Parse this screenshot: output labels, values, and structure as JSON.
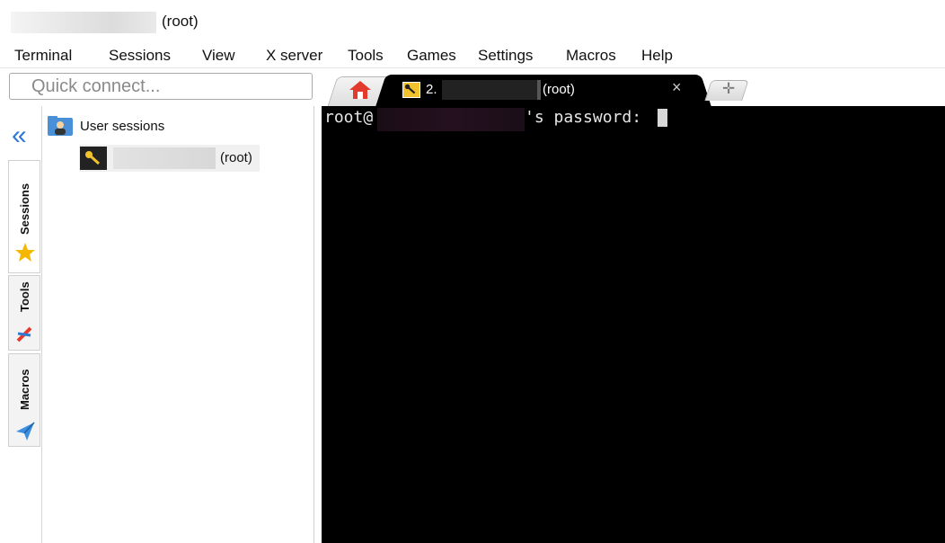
{
  "window": {
    "title_suffix": "(root)"
  },
  "menu": [
    "Terminal",
    "Sessions",
    "View",
    "X server",
    "Tools",
    "Games",
    "Settings",
    "Macros",
    "Help"
  ],
  "quick_connect": {
    "placeholder": "Quick connect..."
  },
  "tabs": {
    "active": {
      "number": "2.",
      "suffix": "(root)",
      "close": "×"
    },
    "new_tab": "✛"
  },
  "sidebar": {
    "collapse": "«",
    "tabs": [
      "Sessions",
      "Tools",
      "Macros"
    ]
  },
  "sessions": {
    "folder_label": "User sessions",
    "items": [
      {
        "suffix": "(root)"
      }
    ]
  },
  "terminal": {
    "prompt_user": "root@",
    "prompt_suffix": "'s password: "
  },
  "colors": {
    "accent": "#2d7ad6",
    "terminal_bg": "#000000",
    "key_icon": "#f2c12e"
  }
}
